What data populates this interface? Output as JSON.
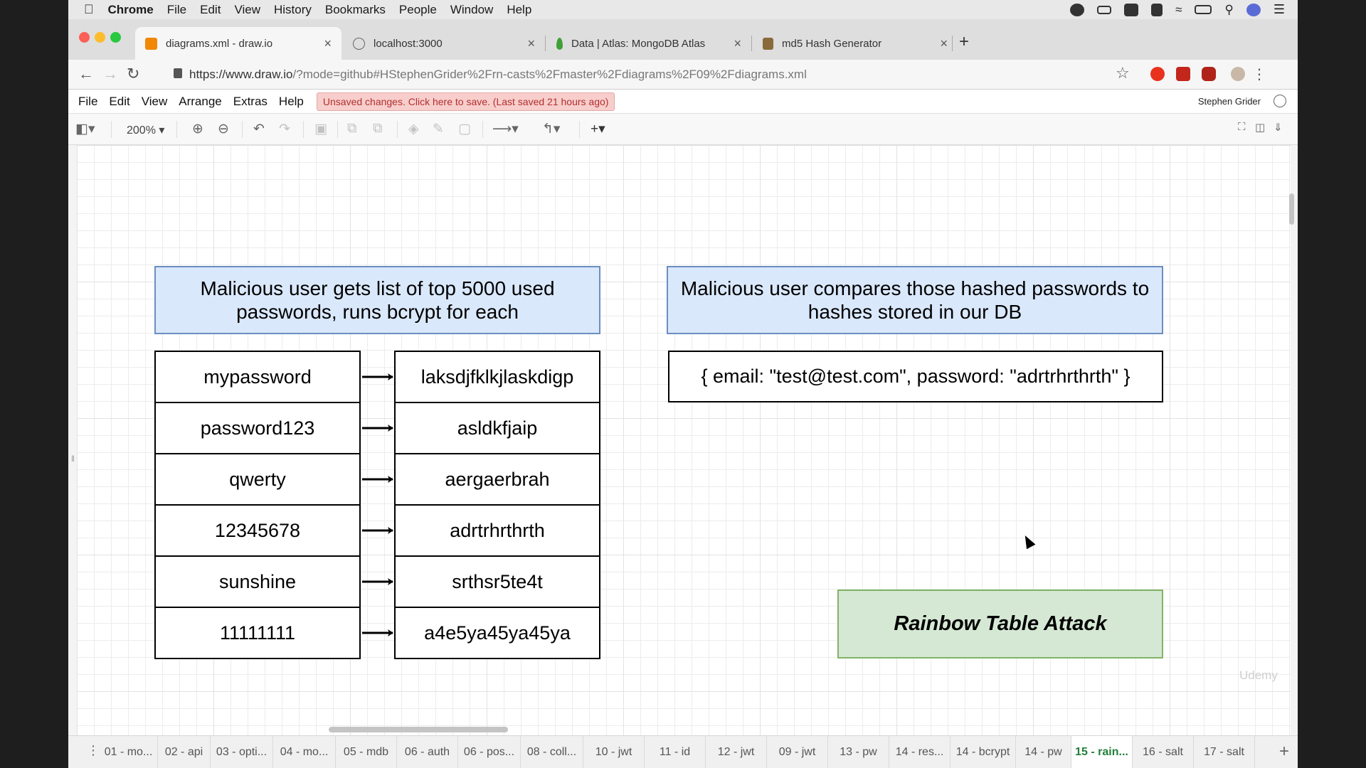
{
  "os_menubar": {
    "items": [
      "Chrome",
      "File",
      "Edit",
      "View",
      "History",
      "Bookmarks",
      "People",
      "Window",
      "Help"
    ]
  },
  "browser": {
    "tabs": [
      {
        "label": "diagrams.xml - draw.io",
        "icon": "drawio-icon",
        "active": true
      },
      {
        "label": "localhost:3000",
        "icon": "globe-icon",
        "active": false
      },
      {
        "label": "Data | Atlas: MongoDB Atlas",
        "icon": "mongodb-leaf-icon",
        "active": false
      },
      {
        "label": "md5 Hash Generator",
        "icon": "md5-icon",
        "active": false
      }
    ],
    "url_host": "https://www.draw.io",
    "url_rest": "/?mode=github#HStephenGrider%2Frn-casts%2Fmaster%2Fdiagrams%2F09%2Fdiagrams.xml"
  },
  "app": {
    "menu": [
      "File",
      "Edit",
      "View",
      "Arrange",
      "Extras",
      "Help"
    ],
    "unsaved": "Unsaved changes. Click here to save. (Last saved 21 hours ago)",
    "user": "Stephen Grider",
    "zoom": "200%"
  },
  "diagram": {
    "left_header": "Malicious user gets list of top 5000 used passwords, runs bcrypt for each",
    "right_header": "Malicious user compares those hashed passwords to hashes stored in our DB",
    "record": "{ email: \"test@test.com\", password: \"adrtrhrthrth\" }",
    "rows": [
      {
        "password": "mypassword",
        "hash": "laksdjfklkjlaskdigp"
      },
      {
        "password": "password123",
        "hash": "asldkfjaip"
      },
      {
        "password": "qwerty",
        "hash": "aergaerbrah"
      },
      {
        "password": "12345678",
        "hash": "adrtrhrthrth"
      },
      {
        "password": "sunshine",
        "hash": "srthsr5te4t"
      },
      {
        "password": "11111111",
        "hash": "a4e5ya45ya45ya"
      }
    ],
    "title_box": "Rainbow Table Attack",
    "watermark": "Udemy"
  },
  "page_tabs": [
    "01 - mo...",
    "02 - api",
    "03 - opti...",
    "04 - mo...",
    "05 - mdb",
    "06 - auth",
    "06 - pos...",
    "08 - coll...",
    "10 - jwt",
    "11 - id",
    "12 - jwt",
    "09 - jwt",
    "13 - pw",
    "14 - res...",
    "14 - bcrypt",
    "14 - pw",
    "15 - rain...",
    "16 - salt",
    "17 - salt"
  ],
  "active_page_tab": "15 - rain...",
  "colors": {
    "blue_fill": "#dae8fc",
    "blue_stroke": "#6c8ebf",
    "green_fill": "#d5e8d4",
    "green_stroke": "#82b366",
    "unsaved_fill": "#f8cecc",
    "active_page_tab_text": "#23803d"
  }
}
